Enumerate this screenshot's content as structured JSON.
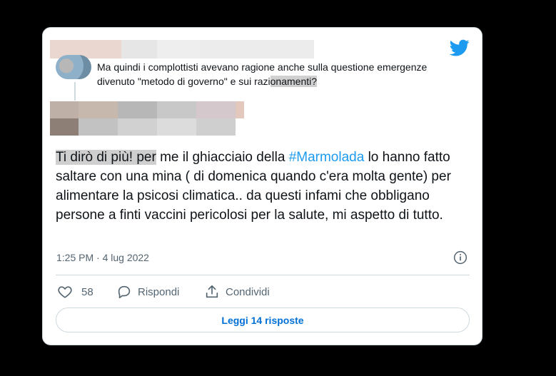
{
  "quoted_tweet": {
    "text_prefix": "Ma quindi i complottisti avevano ragione anche sulla questione emergenze divenuto \"metodo di governo\" e sui razi",
    "text_highlighted": "onamenti?"
  },
  "main_tweet": {
    "text_highlighted": "Ti dirò di più!  per",
    "text_part1": " me il ghiacciaio della ",
    "hashtag": "#Marmolada",
    "text_part2": " lo hanno fatto saltare con una mina ( di domenica quando c'era molta gente) per alimentare  la psicosi climatica.. da questi infami che obbligano persone a finti vaccini pericolosi per la salute,  mi aspetto di tutto."
  },
  "meta": {
    "timestamp": "1:25 PM · 4 lug 2022"
  },
  "actions": {
    "likes_count": "58",
    "reply_label": "Rispondi",
    "share_label": "Condividi"
  },
  "read_replies_label": "Leggi 14 risposte",
  "colors": {
    "brand": "#1d9bf0",
    "link": "#006fd6",
    "muted": "#536471"
  },
  "icons": [
    "twitter-bird-icon",
    "info-icon",
    "heart-icon",
    "reply-bubble-icon",
    "share-icon"
  ]
}
